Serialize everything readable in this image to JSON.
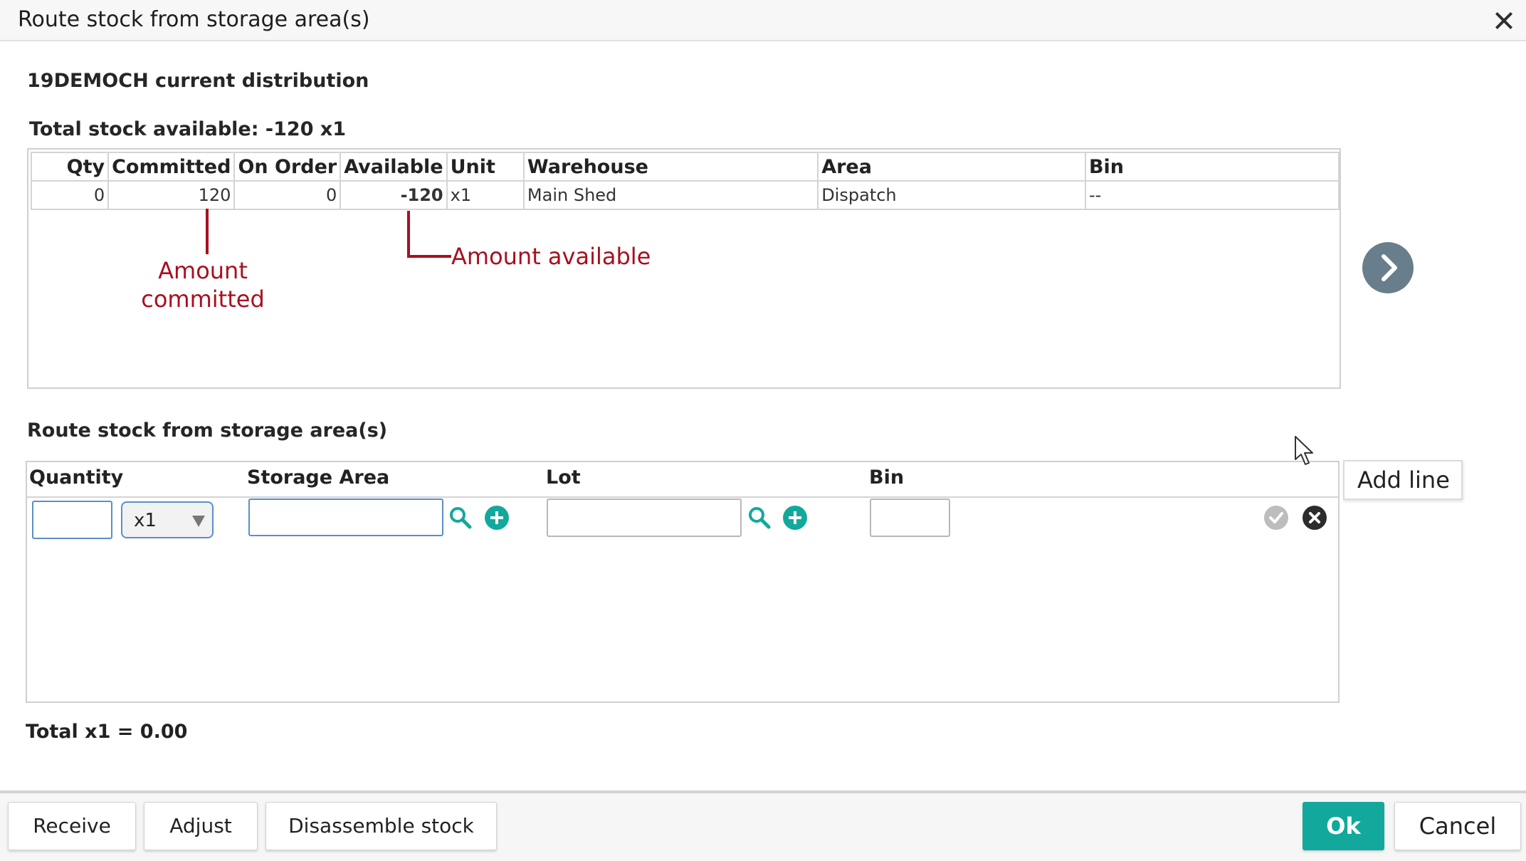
{
  "dialog": {
    "title": "Route stock from storage area(s)"
  },
  "distribution": {
    "heading": "19DEMOCH current distribution",
    "total_label": "Total stock available: -120 x1",
    "columns": [
      "Qty",
      "Committed",
      "On Order",
      "Available",
      "Unit",
      "Warehouse",
      "Area",
      "Bin"
    ],
    "rows": [
      {
        "qty": "0",
        "committed": "120",
        "on_order": "0",
        "available": "-120",
        "unit": "x1",
        "warehouse": "Main Shed",
        "area": "Dispatch",
        "bin": "--"
      }
    ]
  },
  "annotations": {
    "committed": "Amount committed",
    "available": "Amount available"
  },
  "route": {
    "heading": "Route stock from storage area(s)",
    "columns": {
      "quantity": "Quantity",
      "storage_area": "Storage Area",
      "lot": "Lot",
      "bin": "Bin"
    },
    "line": {
      "quantity": "",
      "unit_selected": "x1",
      "storage_area": "",
      "lot": "",
      "bin": ""
    },
    "add_line_tooltip": "Add line",
    "total": "Total x1 = 0.00"
  },
  "footer": {
    "receive": "Receive",
    "adjust": "Adjust",
    "disassemble": "Disassemble stock",
    "ok": "Ok",
    "cancel": "Cancel"
  },
  "colors": {
    "accent": "#12a99c",
    "annotation": "#a8101f",
    "negative": "#e00000",
    "nav": "#687e8c"
  },
  "icons": [
    "close-icon",
    "chevron-right-icon",
    "search-icon",
    "plus-circle-icon",
    "check-circle-icon",
    "x-circle-icon",
    "mouse-pointer-icon"
  ]
}
